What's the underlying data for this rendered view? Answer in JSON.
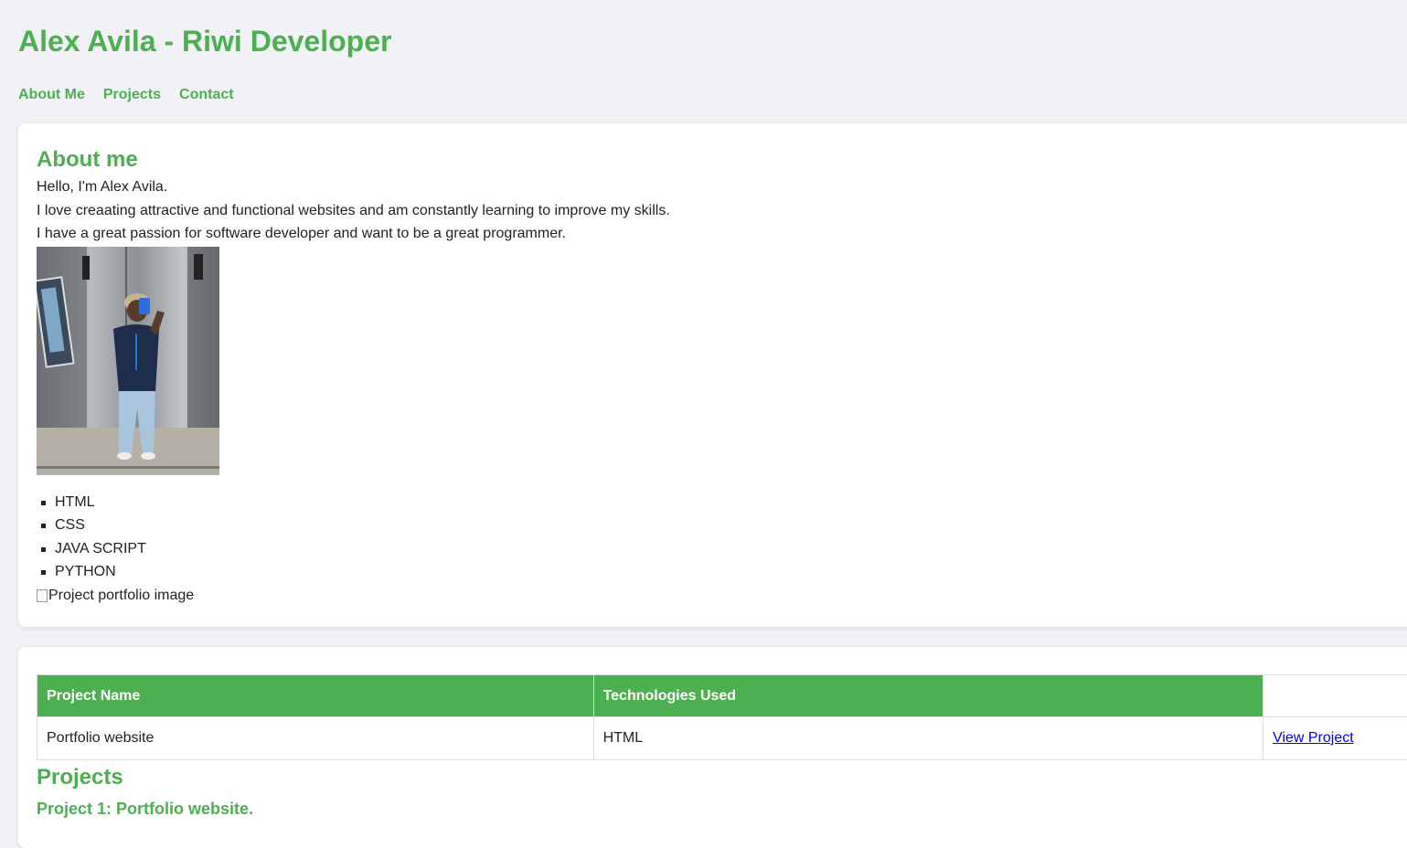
{
  "header": {
    "title": "Alex Avila - Riwi Developer",
    "nav": [
      "About Me",
      "Projects",
      "Contact"
    ]
  },
  "about": {
    "heading": "About me",
    "paragraphs": [
      "Hello, I'm Alex Avila.",
      "I love creaating attractive and functional websites and am constantly learning to improve my skills.",
      "I have a great passion for software developer and want to be a great programmer."
    ],
    "skills": [
      "HTML",
      "CSS",
      "JAVA SCRIPT",
      "PYTHON"
    ],
    "broken_image_alt": "Project portfolio image"
  },
  "projects_table": {
    "headers": [
      "Project Name",
      "Technologies Used",
      ""
    ],
    "rows": [
      {
        "name": "Portfolio website",
        "tech": "HTML",
        "link": "View Project"
      }
    ]
  },
  "projects": {
    "heading": "Projects",
    "project1_title": "Project 1: Portfolio website."
  },
  "colors": {
    "accent": "#4caf50",
    "background": "#f0f2f5",
    "link": "#0000ee"
  }
}
